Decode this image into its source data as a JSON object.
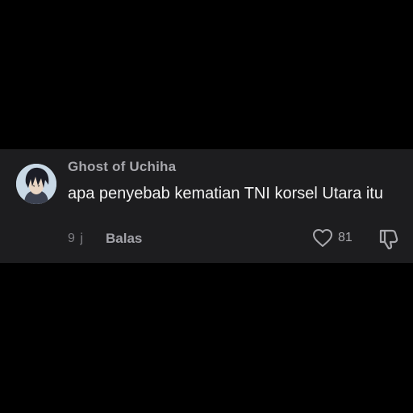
{
  "comment": {
    "username": "Ghost of Uchiha",
    "text": "apa penyebab kematian TNI korsel Utara itu",
    "time": "9 j",
    "reply_label": "Balas",
    "like_count": "81",
    "avatar_icon": "anime-character-avatar",
    "like_icon": "heart-outline-icon",
    "dislike_icon": "thumbs-down-outline-icon"
  },
  "colors": {
    "background": "#000000",
    "card": "#1d1d1f",
    "text_primary": "#f2f2f2",
    "text_secondary": "#a8a8ad"
  }
}
